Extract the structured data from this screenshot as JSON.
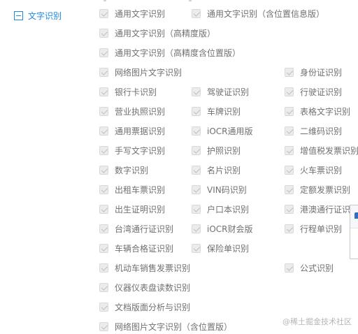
{
  "group": {
    "label": "文字识别",
    "toggle_icon": "minus-box-icon"
  },
  "items": [
    {
      "label": "通用文字识别",
      "checked": true
    },
    {
      "label": "通用文字识别（含位置信息版）",
      "checked": true
    },
    {
      "label": "通用文字识别（高精度版）",
      "checked": true
    },
    {
      "label": "通用文字识别（高精度含位置版）",
      "checked": true
    },
    {
      "label": "网络图片文字识别",
      "checked": true
    },
    {
      "label": "身份证识别",
      "checked": true
    },
    {
      "label": "银行卡识别",
      "checked": true
    },
    {
      "label": "驾驶证识别",
      "checked": true
    },
    {
      "label": "行驶证识别",
      "checked": true
    },
    {
      "label": "营业执照识别",
      "checked": true
    },
    {
      "label": "车牌识别",
      "checked": true
    },
    {
      "label": "表格文字识别",
      "checked": true
    },
    {
      "label": "通用票据识别",
      "checked": true
    },
    {
      "label": "iOCR通用版",
      "checked": true
    },
    {
      "label": "二维码识别",
      "checked": true
    },
    {
      "label": "手写文字识别",
      "checked": true
    },
    {
      "label": "护照识别",
      "checked": true
    },
    {
      "label": "增值税发票识别",
      "checked": true
    },
    {
      "label": "数字识别",
      "checked": true
    },
    {
      "label": "名片识别",
      "checked": true
    },
    {
      "label": "火车票识别",
      "checked": true
    },
    {
      "label": "出租车票识别",
      "checked": true
    },
    {
      "label": "VIN码识别",
      "checked": true
    },
    {
      "label": "定额发票识别",
      "checked": true
    },
    {
      "label": "出生证明识别",
      "checked": true
    },
    {
      "label": "户口本识别",
      "checked": true
    },
    {
      "label": "港澳通行证识别",
      "checked": true
    },
    {
      "label": "台湾通行证识别",
      "checked": true
    },
    {
      "label": "iOCR财会版",
      "checked": true
    },
    {
      "label": "行程单识别",
      "checked": true
    },
    {
      "label": "车辆合格证识别",
      "checked": true
    },
    {
      "label": "保险单识别",
      "checked": true
    },
    {
      "label": "机动车销售发票识别",
      "checked": true
    },
    {
      "label": "公式识别",
      "checked": true
    },
    {
      "label": "仪器仪表盘读数识别",
      "checked": true
    },
    {
      "label": "文档版面分析与识别",
      "checked": true
    },
    {
      "label": "网络图片文字识别（含位置版）",
      "checked": true
    }
  ],
  "watermark": "@稀土掘金技术社区",
  "dialog": {
    "icon": "dialog-app-icon"
  }
}
